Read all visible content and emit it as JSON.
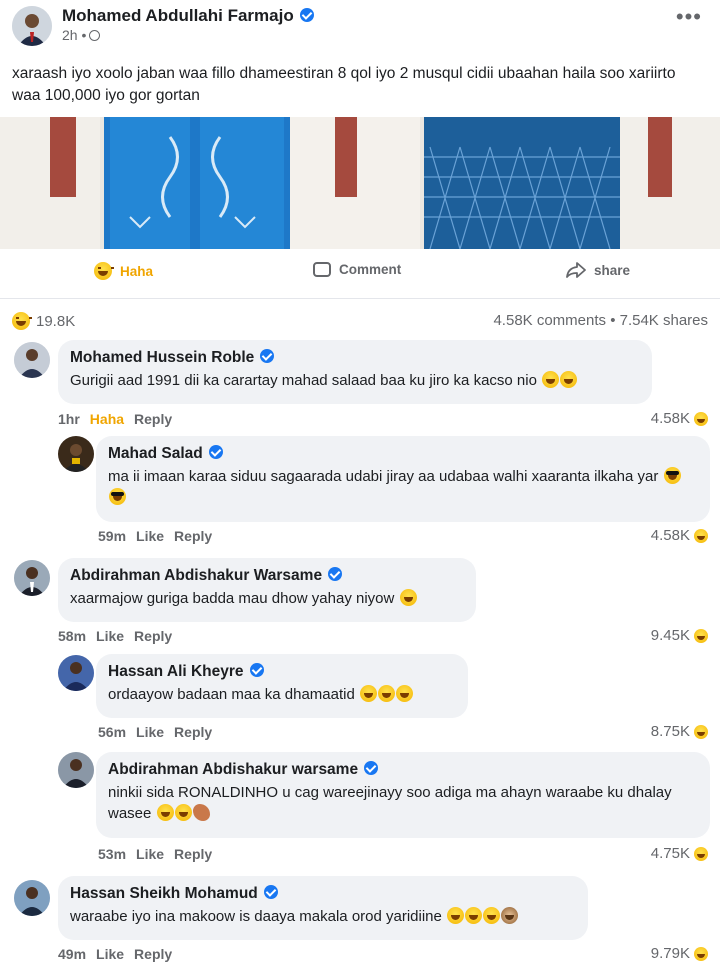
{
  "post": {
    "author": "Mohamed Abdullahi Farmajo",
    "time": "2h •",
    "text": "xaraash iyo xoolo jaban waa fillo dhameestiran 8 qol iyo 2 musqul cidii ubaahan haila soo xariirto  waa 100,000 iyo gor gortan"
  },
  "actions": {
    "haha": "Haha",
    "comment": "Comment",
    "share": "share"
  },
  "stats": {
    "reactions": "19.8K",
    "comments_shares": "4.58K comments • 7.54K shares"
  },
  "comments": [
    {
      "name": "Mohamed Hussein Roble",
      "text": "Gurigii aad 1991 dii ka carartay mahad salaad baa ku jiro ka kacso nio",
      "time": "1hr",
      "reaction_label": "Haha",
      "reply": "Reply",
      "count": "4.58K"
    },
    {
      "name": "Mahad Salad",
      "text": "ma ii imaan karaa siduu sagaarada udabi jiray aa udabaa walhi xaaranta ilkaha yar",
      "time": "59m",
      "like": "Like",
      "reply": "Reply",
      "count": "4.58K"
    },
    {
      "name": "Abdirahman Abdishakur Warsame",
      "text": "xaarmajow guriga badda mau dhow yahay niyow",
      "time": "58m",
      "like": "Like",
      "reply": "Reply",
      "count": "9.45K"
    },
    {
      "name": "Hassan Ali Kheyre",
      "text": "ordaayow badaan maa ka dhamaatid",
      "time": "56m",
      "like": "Like",
      "reply": "Reply",
      "count": "8.75K"
    },
    {
      "name": "Abdirahman Abdishakur warsame",
      "text": "ninkii sida RONALDINHO u cag wareejinayy soo adiga ma ahayn waraabe ku dhalay wasee",
      "time": "53m",
      "like": "Like",
      "reply": "Reply",
      "count": "4.75K"
    },
    {
      "name": "Hassan Sheikh Mohamud",
      "text": "waraabe iyo ina makoow is daaya makala orod yaridiine",
      "time": "49m",
      "like": "Like",
      "reply": "Reply",
      "count": "9.79K"
    }
  ],
  "icons": {
    "haha": "haha-emoji-icon",
    "comment": "comment-icon",
    "share": "share-icon",
    "more": "more-icon",
    "globe": "globe-icon",
    "verified": "verified-icon"
  },
  "colors": {
    "haha": "#f0a500",
    "verified": "#1877f2",
    "bubble": "#f0f2f5",
    "muted": "#65676b"
  }
}
